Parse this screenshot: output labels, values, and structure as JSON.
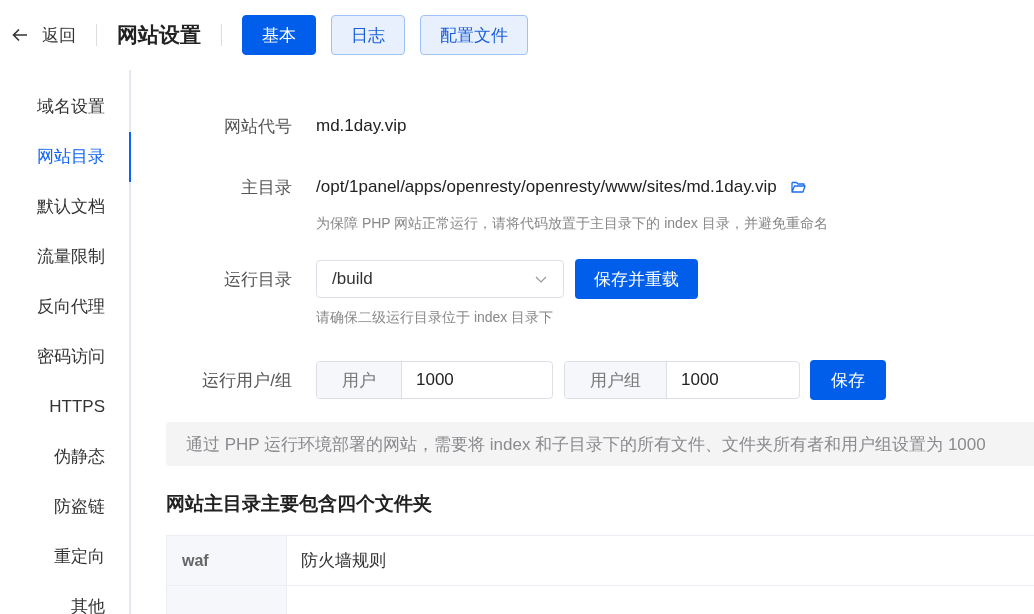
{
  "header": {
    "back": "返回",
    "title": "网站设置",
    "tabs": [
      {
        "label": "基本",
        "selected": true
      },
      {
        "label": "日志",
        "selected": false
      },
      {
        "label": "配置文件",
        "selected": false
      }
    ]
  },
  "sidebar": {
    "items": [
      {
        "label": "域名设置",
        "selected": false
      },
      {
        "label": "网站目录",
        "selected": true
      },
      {
        "label": "默认文档",
        "selected": false
      },
      {
        "label": "流量限制",
        "selected": false
      },
      {
        "label": "反向代理",
        "selected": false
      },
      {
        "label": "密码访问",
        "selected": false
      },
      {
        "label": "HTTPS",
        "selected": false
      },
      {
        "label": "伪静态",
        "selected": false
      },
      {
        "label": "防盗链",
        "selected": false
      },
      {
        "label": "重定向",
        "selected": false
      },
      {
        "label": "其他",
        "selected": false
      }
    ]
  },
  "form": {
    "site_code": {
      "label": "网站代号",
      "value": "md.1day.vip"
    },
    "main_dir": {
      "label": "主目录",
      "value": "/opt/1panel/apps/openresty/openresty/www/sites/md.1day.vip",
      "hint": "为保障 PHP 网站正常运行，请将代码放置于主目录下的 index 目录，并避免重命名"
    },
    "run_dir": {
      "label": "运行目录",
      "value": "/build",
      "button": "保存并重载",
      "hint": "请确保二级运行目录位于 index 目录下"
    },
    "run_user": {
      "label": "运行用户/组",
      "user_prefix": "用户",
      "user": "1000",
      "group_prefix": "用户组",
      "group": "1000",
      "button": "保存"
    },
    "alert": "通过 PHP 运行环境部署的网站，需要将 index 和子目录下的所有文件、文件夹所有者和用户组设置为 1000"
  },
  "folders": {
    "title": "网站主目录主要包含四个文件夹",
    "rows": [
      {
        "name": "waf",
        "description": "防火墙规则"
      }
    ]
  }
}
